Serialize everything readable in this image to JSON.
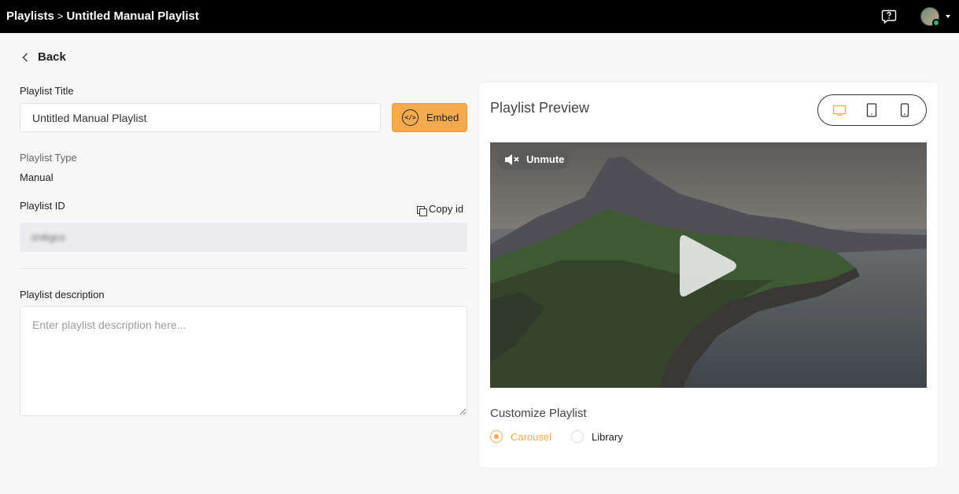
{
  "header": {
    "breadcrumb_root": "Playlists",
    "breadcrumb_separator": ">",
    "breadcrumb_current": "Untitled Manual Playlist",
    "help_icon": "help-chat-icon",
    "avatar_status": "online"
  },
  "nav": {
    "back_label": "Back"
  },
  "form": {
    "title_label": "Playlist Title",
    "title_value": "Untitled Manual Playlist",
    "embed_label": "Embed",
    "embed_icon_text": "</>",
    "type_label": "Playlist Type",
    "type_value": "Manual",
    "id_label": "Playlist ID",
    "copy_id_label": "Copy id",
    "id_value": "izvkgcs",
    "description_label": "Playlist description",
    "description_placeholder": "Enter playlist description here..."
  },
  "preview": {
    "title": "Playlist Preview",
    "devices": [
      "desktop",
      "tablet",
      "mobile"
    ],
    "active_device": "desktop",
    "unmute_label": "Unmute",
    "customize_label": "Customize Playlist",
    "options": [
      "Carousel",
      "Library"
    ],
    "selected_option": "Carousel"
  },
  "colors": {
    "accent": "#f5aa50",
    "topbar": "#000000",
    "background": "#f7f7f7",
    "online": "#2bb673"
  }
}
